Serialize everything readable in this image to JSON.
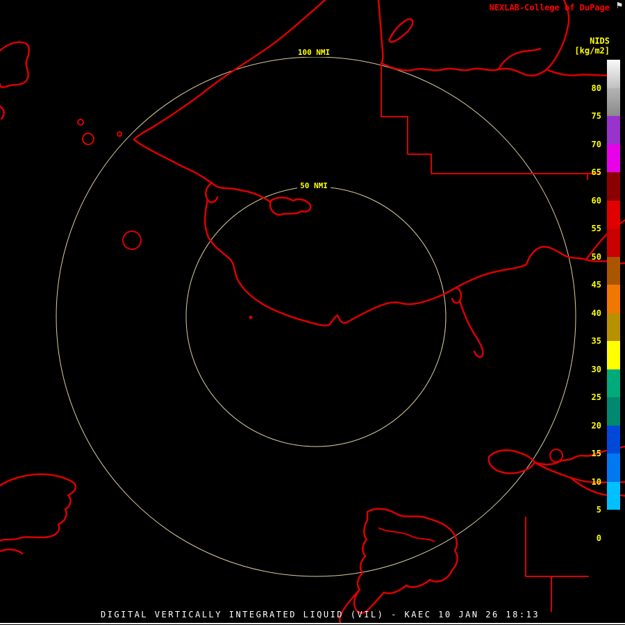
{
  "colors": {
    "background": "#000000",
    "coastline": "#dd0000",
    "ring": "#dccfa2",
    "label-yellow": "#ffff00",
    "brand-red": "#ff0000",
    "caption-white": "#ffffff",
    "flag-white": "#e0e0e0"
  },
  "header": {
    "brand": "NEXLAB-College of DuPage",
    "flag_icon_glyph": "⚑"
  },
  "legend": {
    "title": "NIDS",
    "units": "[kg/m2]",
    "ticks": [
      "80",
      "75",
      "70",
      "65",
      "60",
      "55",
      "50",
      "45",
      "40",
      "35",
      "30",
      "25",
      "20",
      "15",
      "10",
      "5",
      "0"
    ],
    "segments": [
      {
        "range": "80-85",
        "color": "#fafafa",
        "color2": "#c0c0c0"
      },
      {
        "range": "75-80",
        "color": "#b4b4b4",
        "color2": "#8a8a8a"
      },
      {
        "range": "70-75",
        "color": "#9933cc"
      },
      {
        "range": "65-70",
        "color": "#e800e8"
      },
      {
        "range": "60-65",
        "color": "#8b0000"
      },
      {
        "range": "55-60",
        "color": "#e00000"
      },
      {
        "range": "50-55",
        "color": "#c80000"
      },
      {
        "range": "45-50",
        "color": "#aa5500"
      },
      {
        "range": "40-45",
        "color": "#f07800"
      },
      {
        "range": "35-40",
        "color": "#b89000"
      },
      {
        "range": "30-35",
        "color": "#ffff00"
      },
      {
        "range": "25-30",
        "color": "#00aa7a"
      },
      {
        "range": "20-25",
        "color": "#008870"
      },
      {
        "range": "15-20",
        "color": "#0048d8"
      },
      {
        "range": "10-15",
        "color": "#0078f0"
      },
      {
        "range": "5-10",
        "color": "#00c0ff"
      },
      {
        "range": "0-5",
        "color": "#000000"
      }
    ]
  },
  "map": {
    "range_rings": [
      {
        "label": "100 NMI"
      },
      {
        "label": "50 NMI"
      }
    ]
  },
  "footer": {
    "caption": "DIGITAL VERTICALLY INTEGRATED LIQUID (VIL) - KAEC 10 JAN 26 18:13"
  }
}
